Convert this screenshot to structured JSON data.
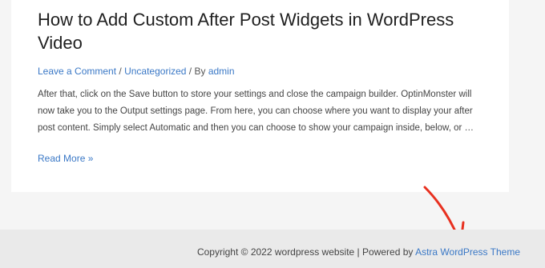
{
  "post": {
    "title": "How to Add Custom After Post Widgets in WordPress Video",
    "meta": {
      "comment_link": "Leave a Comment",
      "sep1": " / ",
      "category": "Uncategorized",
      "sep2": " / By ",
      "author": "admin"
    },
    "excerpt": "After that, click on the Save button to store your settings and close the campaign builder. OptinMonster will now take you to the Output settings page. From here, you can choose where you want to display your after post content. Simply select Automatic and then you can choose to show your campaign inside, below, or …",
    "read_more": "Read More »"
  },
  "footer": {
    "copyright": "Copyright © 2022 wordpress website | Powered by ",
    "theme_link": "Astra WordPress Theme"
  },
  "colors": {
    "link": "#3a78c6",
    "annotation_arrow": "#e8301f",
    "page_bg": "#f5f5f5",
    "footer_bg": "#eaeaea"
  },
  "icons": {
    "annotation": "red-arrow-annotation"
  }
}
